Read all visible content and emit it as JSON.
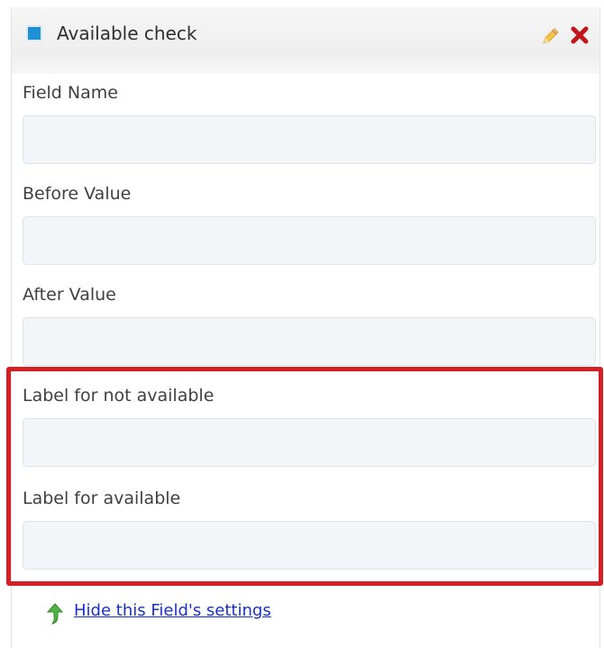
{
  "header": {
    "title": "Available check",
    "icon": "blue-square-icon",
    "edit_icon": "pencil-icon",
    "close_icon": "close-icon",
    "accent": "#1e90d6",
    "close_color": "#c1161c"
  },
  "fields": [
    {
      "label": "Field Name",
      "value": ""
    },
    {
      "label": "Before Value",
      "value": ""
    },
    {
      "label": "After Value",
      "value": ""
    },
    {
      "label": "Label for not available",
      "value": ""
    },
    {
      "label": "Label for available",
      "value": ""
    }
  ],
  "highlight": {
    "color": "#d41f26"
  },
  "footer": {
    "toggle_link": "Hide this Field's settings",
    "icon": "green-arrow-up-icon"
  }
}
